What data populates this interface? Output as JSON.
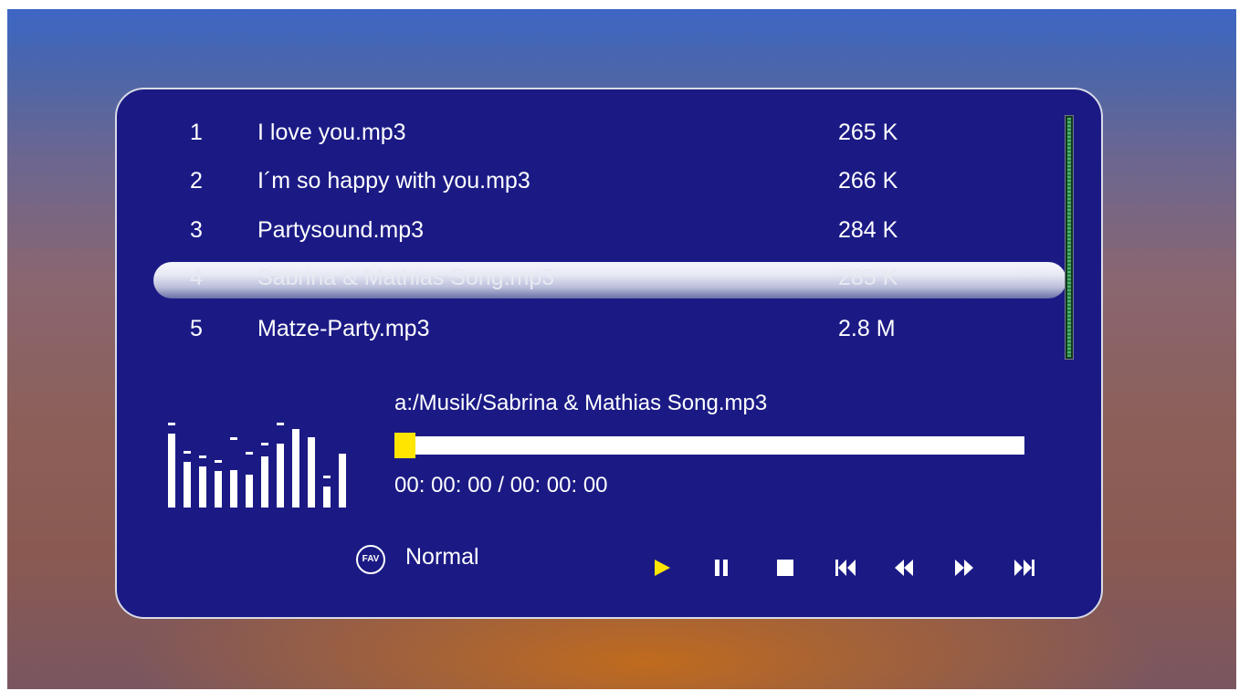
{
  "playlist": [
    {
      "num": "1",
      "name": "I love you.mp3",
      "size": "265 K"
    },
    {
      "num": "2",
      "name": "I´m so happy with you.mp3",
      "size": "266 K"
    },
    {
      "num": "3",
      "name": "Partysound.mp3",
      "size": "284 K"
    },
    {
      "num": "4",
      "name": "Sabrina & Mathias Song.mp3",
      "size": "285 K",
      "marker": "***"
    },
    {
      "num": "5",
      "name": "Matze-Party.mp3",
      "size": "2.8 M"
    }
  ],
  "selected_index": 3,
  "now_playing": {
    "path": "a:/Musik/Sabrina & Mathias Song.mp3",
    "time": "00: 00: 00 / 00: 00: 00",
    "progress": 0
  },
  "play_mode": {
    "icon_text": "FAV",
    "label": "Normal"
  },
  "controls": [
    {
      "name": "play-icon",
      "active": true
    },
    {
      "name": "pause-icon",
      "active": false
    },
    {
      "name": "stop-icon",
      "active": false
    },
    {
      "name": "previous-track-icon",
      "active": false
    },
    {
      "name": "rewind-icon",
      "active": false
    },
    {
      "name": "fast-forward-icon",
      "active": false
    },
    {
      "name": "next-track-icon",
      "active": false
    }
  ],
  "equalizer_levels": [
    0.9,
    0.55,
    0.5,
    0.44,
    0.45,
    0.4,
    0.62,
    0.78,
    0.95,
    0.85,
    0.26,
    0.66
  ],
  "equalizer_peaks": [
    1.0,
    0.65,
    0.6,
    0.54,
    0.82,
    0.64,
    0.76,
    1.0,
    null,
    null,
    0.36,
    null
  ],
  "colors": {
    "panel": "#1b1a85",
    "accent": "#ffe500",
    "text": "#ffffff"
  }
}
